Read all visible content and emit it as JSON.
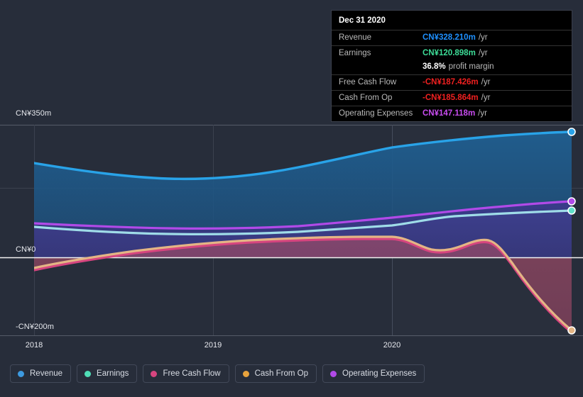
{
  "background": "#272d3a",
  "axis": {
    "y_labels": [
      {
        "text": "CN¥350m",
        "value": 350
      },
      {
        "text": "CN¥0",
        "value": 0
      },
      {
        "text": "-CN¥200m",
        "value": -200
      }
    ],
    "x_labels": [
      "2018",
      "2019",
      "2020"
    ]
  },
  "tooltip": {
    "title": "Dec 31 2020",
    "rows": [
      {
        "key": "Revenue",
        "value": "CN¥328.210m",
        "unit": "/yr",
        "color": "#1e90ff"
      },
      {
        "key": "Earnings",
        "value": "CN¥120.898m",
        "unit": "/yr",
        "color": "#3ddc97"
      },
      {
        "key": "",
        "value": "36.8%",
        "unit": "profit margin",
        "color": "#ffffff"
      },
      {
        "key": "Free Cash Flow",
        "value": "-CN¥187.426m",
        "unit": "/yr",
        "color": "#ef2020"
      },
      {
        "key": "Cash From Op",
        "value": "-CN¥185.864m",
        "unit": "/yr",
        "color": "#ef2020"
      },
      {
        "key": "Operating Expenses",
        "value": "CN¥147.118m",
        "unit": "/yr",
        "color": "#c94cf0"
      }
    ]
  },
  "legend": [
    {
      "label": "Revenue",
      "color": "#3d9ae0"
    },
    {
      "label": "Earnings",
      "color": "#4fddb6"
    },
    {
      "label": "Free Cash Flow",
      "color": "#d6457f"
    },
    {
      "label": "Cash From Op",
      "color": "#e8a33d"
    },
    {
      "label": "Operating Expenses",
      "color": "#b14ae8"
    }
  ],
  "chart_data": {
    "type": "area",
    "title": "Dec 31 2020",
    "xlabel": "",
    "ylabel": "CN¥",
    "ylim": [
      -200,
      350
    ],
    "xlim": [
      "2018",
      "2020-12-31"
    ],
    "grid": true,
    "legend_position": "bottom-left",
    "yticks": [
      350,
      0,
      -200
    ],
    "ytick_labels": [
      "CN¥350m",
      "CN¥0",
      "-CN¥200m"
    ],
    "xticks": [
      "2018",
      "2019",
      "2020"
    ],
    "forecast_divider_x": "2020",
    "x": [
      "2018.0",
      "2018.25",
      "2018.5",
      "2018.75",
      "2019.0",
      "2019.25",
      "2019.5",
      "2019.75",
      "2020.0",
      "2020.25",
      "2020.5",
      "2020.75",
      "2020.99"
    ],
    "series": [
      {
        "name": "Revenue",
        "color": "#3d9ae0",
        "units": "CN¥m",
        "values": [
          248,
          238,
          231,
          227,
          226,
          229,
          235,
          245,
          262,
          281,
          299,
          315,
          328.21
        ],
        "end_value": 328.21
      },
      {
        "name": "Earnings",
        "color": "#8fd9e8",
        "units": "CN¥m",
        "values": [
          80,
          75,
          72,
          70,
          70,
          71,
          73,
          76,
          88,
          99,
          107,
          114,
          120.898
        ],
        "end_value": 120.898,
        "profit_margin_pct": 36.8
      },
      {
        "name": "Free Cash Flow",
        "color": "#d6457f",
        "units": "CN¥m",
        "values": [
          -28,
          -6,
          14,
          31,
          44,
          55,
          63,
          68,
          70,
          30,
          42,
          -60,
          -187.426
        ],
        "end_value": -187.426
      },
      {
        "name": "Cash From Op",
        "color": "#e8a33d",
        "units": "CN¥m",
        "values": [
          -27,
          -5,
          15,
          32,
          45,
          56,
          64,
          69,
          71,
          31,
          43,
          -58,
          -185.864
        ],
        "end_value": -185.864
      },
      {
        "name": "Operating Expenses",
        "color": "#b14ae8",
        "units": "CN¥m",
        "values": [
          90,
          88,
          87,
          86,
          86,
          88,
          91,
          96,
          108,
          122,
          133,
          141,
          147.118
        ],
        "end_value": 147.118
      }
    ]
  }
}
